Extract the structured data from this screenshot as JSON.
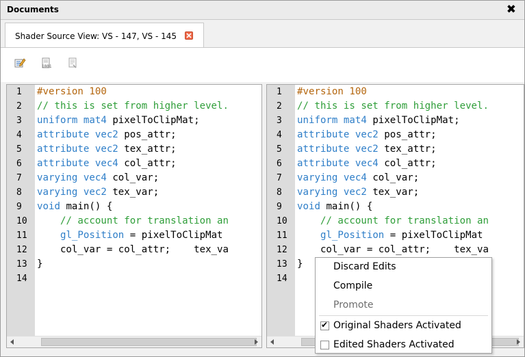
{
  "window": {
    "title": "Documents",
    "close_glyph": "✖"
  },
  "tab": {
    "label": "Shader Source View: VS - 147, VS - 145",
    "close_icon": "close-tab-icon",
    "close_color": "#ef6a4a"
  },
  "toolbar": {
    "buttons": [
      {
        "icon": "edit-icon"
      },
      {
        "icon": "compile-icon"
      },
      {
        "icon": "promote-icon"
      }
    ]
  },
  "colors": {
    "keyword": "#2e7ec8",
    "comment": "#2f9e39",
    "preprocessor": "#b4660e",
    "gutter": "#dcdcdc"
  },
  "editors": [
    {
      "name": "original",
      "lines": [
        {
          "n": "1",
          "segs": [
            [
              "pp",
              "#version 100"
            ]
          ]
        },
        {
          "n": "2",
          "segs": [
            [
              "cm",
              "// this is set from higher level."
            ]
          ]
        },
        {
          "n": "3",
          "segs": [
            [
              "kw",
              "uniform mat4"
            ],
            [
              "t",
              " pixelToClipMat;"
            ]
          ]
        },
        {
          "n": "4",
          "segs": [
            [
              "kw",
              "attribute vec2"
            ],
            [
              "t",
              " pos_attr;"
            ]
          ]
        },
        {
          "n": "5",
          "segs": [
            [
              "kw",
              "attribute vec2"
            ],
            [
              "t",
              " tex_attr;"
            ]
          ]
        },
        {
          "n": "6",
          "segs": [
            [
              "kw",
              "attribute vec4"
            ],
            [
              "t",
              " col_attr;"
            ]
          ]
        },
        {
          "n": "7",
          "segs": [
            [
              "kw",
              "varying vec4"
            ],
            [
              "t",
              " col_var;"
            ]
          ]
        },
        {
          "n": "8",
          "segs": [
            [
              "kw",
              "varying vec2"
            ],
            [
              "t",
              " tex_var;"
            ]
          ]
        },
        {
          "n": "9",
          "segs": [
            [
              "kw",
              "void"
            ],
            [
              "t",
              " main() {"
            ]
          ]
        },
        {
          "n": "10",
          "segs": [
            [
              "t",
              "    "
            ],
            [
              "cm",
              "// account for translation an"
            ]
          ]
        },
        {
          "n": "11",
          "segs": [
            [
              "t",
              "    "
            ],
            [
              "kw",
              "gl_Position"
            ],
            [
              "t",
              " = pixelToClipMat"
            ]
          ]
        },
        {
          "n": "12",
          "segs": [
            [
              "t",
              "    col_var = col_attr;    tex_va"
            ]
          ]
        },
        {
          "n": "13",
          "segs": [
            [
              "t",
              "}"
            ]
          ]
        },
        {
          "n": "14",
          "segs": []
        }
      ]
    },
    {
      "name": "edited",
      "lines": [
        {
          "n": "1",
          "segs": [
            [
              "pp",
              "#version 100"
            ]
          ]
        },
        {
          "n": "2",
          "segs": [
            [
              "cm",
              "// this is set from higher level."
            ]
          ]
        },
        {
          "n": "3",
          "segs": [
            [
              "kw",
              "uniform mat4"
            ],
            [
              "t",
              " pixelToClipMat;"
            ]
          ]
        },
        {
          "n": "4",
          "segs": [
            [
              "kw",
              "attribute vec2"
            ],
            [
              "t",
              " pos_attr;"
            ]
          ]
        },
        {
          "n": "5",
          "segs": [
            [
              "kw",
              "attribute vec2"
            ],
            [
              "t",
              " tex_attr;"
            ]
          ]
        },
        {
          "n": "6",
          "segs": [
            [
              "kw",
              "attribute vec4"
            ],
            [
              "t",
              " col_attr;"
            ]
          ]
        },
        {
          "n": "7",
          "segs": [
            [
              "kw",
              "varying vec4"
            ],
            [
              "t",
              " col_var;"
            ]
          ]
        },
        {
          "n": "8",
          "segs": [
            [
              "kw",
              "varying vec2"
            ],
            [
              "t",
              " tex_var;"
            ]
          ]
        },
        {
          "n": "9",
          "segs": [
            [
              "kw",
              "void"
            ],
            [
              "t",
              " main() {"
            ]
          ]
        },
        {
          "n": "10",
          "segs": [
            [
              "t",
              "    "
            ],
            [
              "cm",
              "// account for translation an"
            ]
          ]
        },
        {
          "n": "11",
          "segs": [
            [
              "t",
              "    "
            ],
            [
              "kw",
              "gl_Position"
            ],
            [
              "t",
              " = pixelToClipMat"
            ]
          ]
        },
        {
          "n": "12",
          "segs": [
            [
              "t",
              "    col_var = col_attr;    tex_va"
            ]
          ]
        },
        {
          "n": "13",
          "segs": [
            [
              "t",
              "}"
            ]
          ]
        },
        {
          "n": "14",
          "segs": []
        }
      ]
    }
  ],
  "context_menu": {
    "items": [
      {
        "label": "Discard Edits",
        "enabled": true
      },
      {
        "label": "Compile",
        "enabled": true
      },
      {
        "label": "Promote",
        "enabled": false
      }
    ],
    "checks": [
      {
        "label": "Original Shaders Activated",
        "checked": true
      },
      {
        "label": "Edited Shaders Activated",
        "checked": false
      }
    ],
    "check_glyph": "✔"
  }
}
